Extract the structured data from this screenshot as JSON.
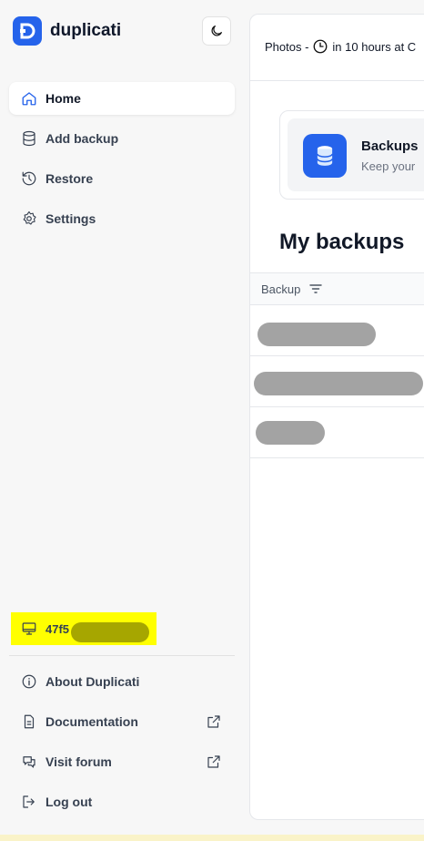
{
  "app": {
    "name": "duplicati"
  },
  "nav": [
    {
      "label": "Home",
      "icon": "home-icon",
      "active": true
    },
    {
      "label": "Add backup",
      "icon": "database-icon"
    },
    {
      "label": "Restore",
      "icon": "history-icon"
    },
    {
      "label": "Settings",
      "icon": "gear-icon"
    }
  ],
  "machine": {
    "id_prefix": "47f5"
  },
  "footer": [
    {
      "label": "About Duplicati",
      "icon": "info-icon"
    },
    {
      "label": "Documentation",
      "icon": "document-icon",
      "external": true
    },
    {
      "label": "Visit forum",
      "icon": "chat-icon",
      "external": true
    },
    {
      "label": "Log out",
      "icon": "logout-icon"
    }
  ],
  "status": {
    "prefix": "Photos -",
    "schedule": "in 10 hours at C"
  },
  "card": {
    "title": "Backups",
    "subtitle": "Keep your"
  },
  "section": {
    "title": "My backups"
  },
  "table": {
    "column": "Backup"
  },
  "colors": {
    "accent": "#2563eb",
    "highlight": "#ffff00",
    "redaction": "#a3a3a3"
  }
}
